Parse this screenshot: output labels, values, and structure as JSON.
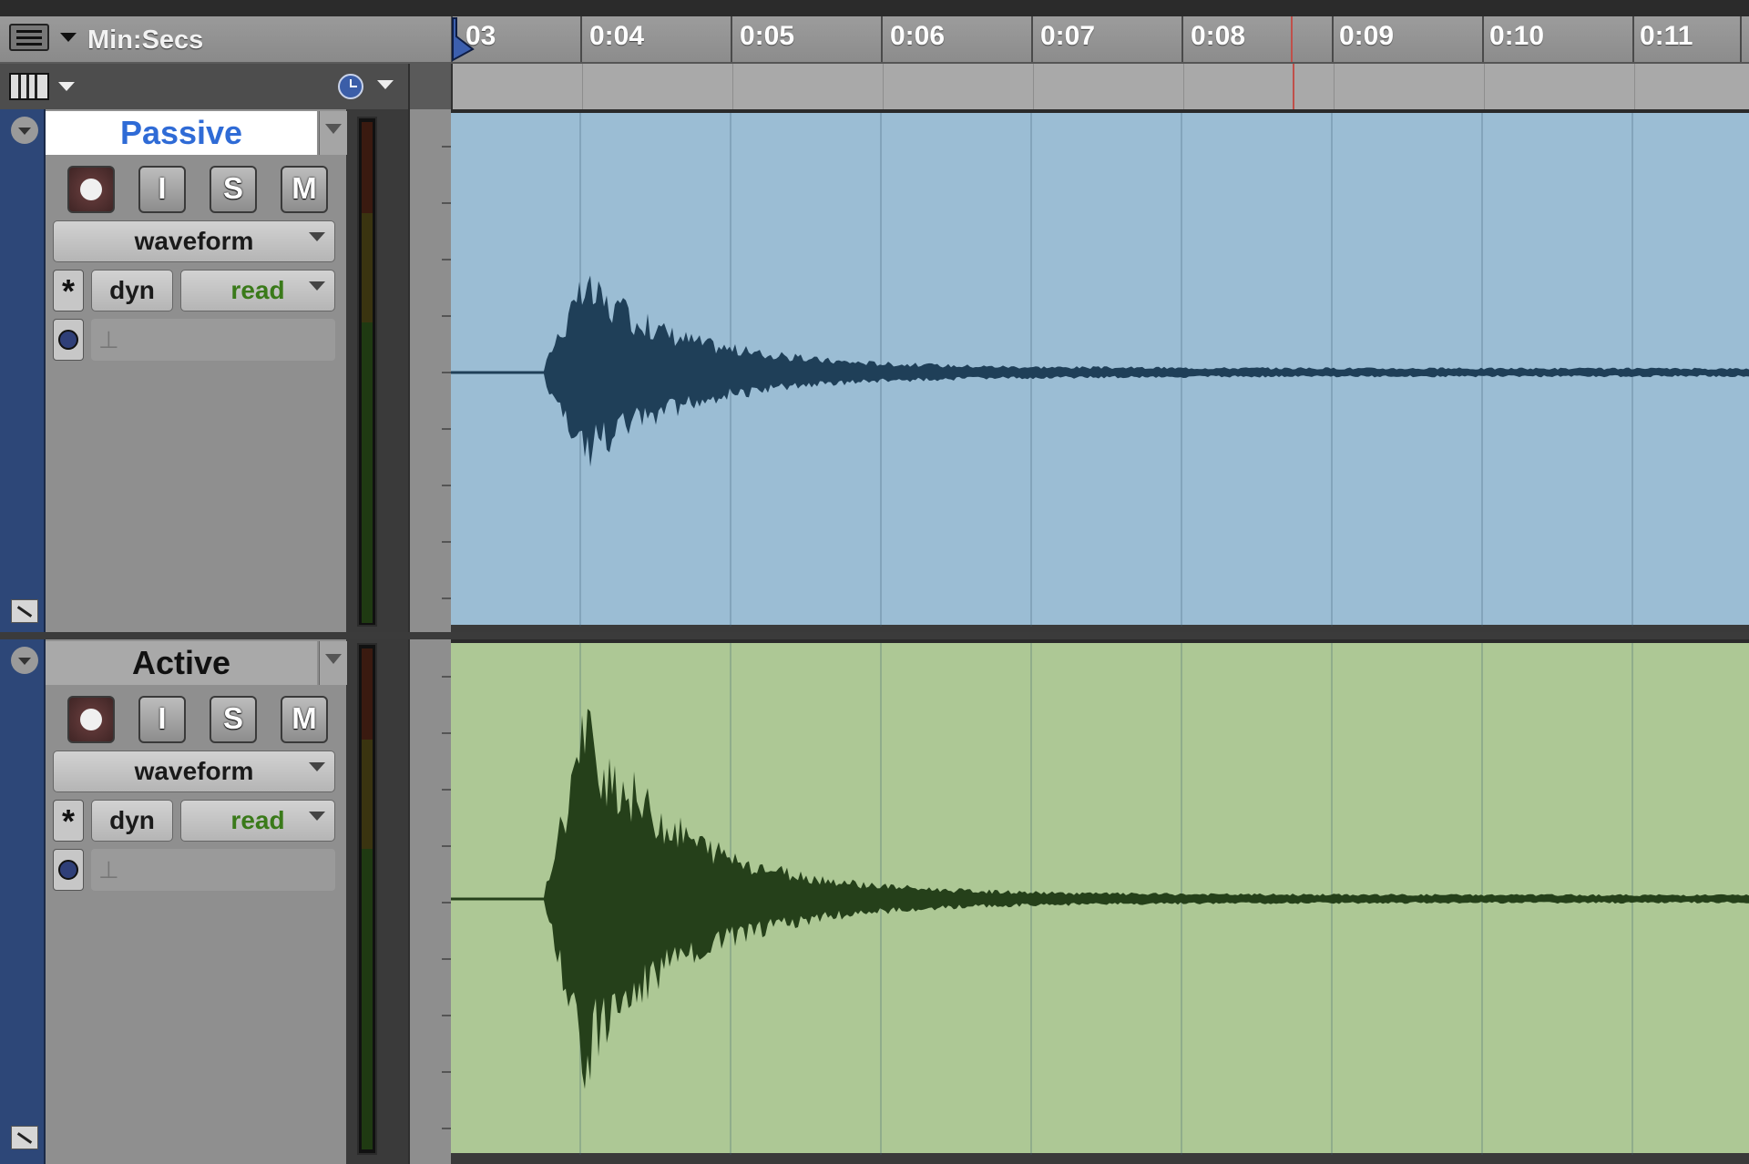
{
  "ruler": {
    "format_label": "Min:Secs",
    "ticks": [
      "0:03",
      "0:04",
      "0:05",
      "0:06",
      "0:07",
      "0:08",
      "0:09",
      "0:10",
      "0:11"
    ],
    "first_tick_visible_text": "03"
  },
  "tracks": [
    {
      "name": "Passive",
      "name_color": "#2f6bd6",
      "name_bg": "#ffffff",
      "rec_label": "",
      "input_label": "I",
      "solo_label": "S",
      "mute_label": "M",
      "view_mode": "waveform",
      "star_label": "*",
      "dyn_label": "dyn",
      "automation_mode": "read",
      "region_color": "#9bbdd4",
      "waveform_color": "#1f3f58"
    },
    {
      "name": "Active",
      "name_color": "#111111",
      "name_bg": "#a9a9a9",
      "rec_label": "",
      "input_label": "I",
      "solo_label": "S",
      "mute_label": "M",
      "view_mode": "waveform",
      "star_label": "*",
      "dyn_label": "dyn",
      "automation_mode": "read",
      "region_color": "#adc895",
      "waveform_color": "#25401a"
    }
  ],
  "icons": {
    "menu": "hamburger-icon",
    "columns": "columns-icon",
    "timebase": "clock-icon",
    "collapse": "collapse-icon",
    "resize": "track-resize-icon"
  },
  "colors": {
    "playhead": "#c0504a",
    "ruler_bg": "#949494"
  }
}
